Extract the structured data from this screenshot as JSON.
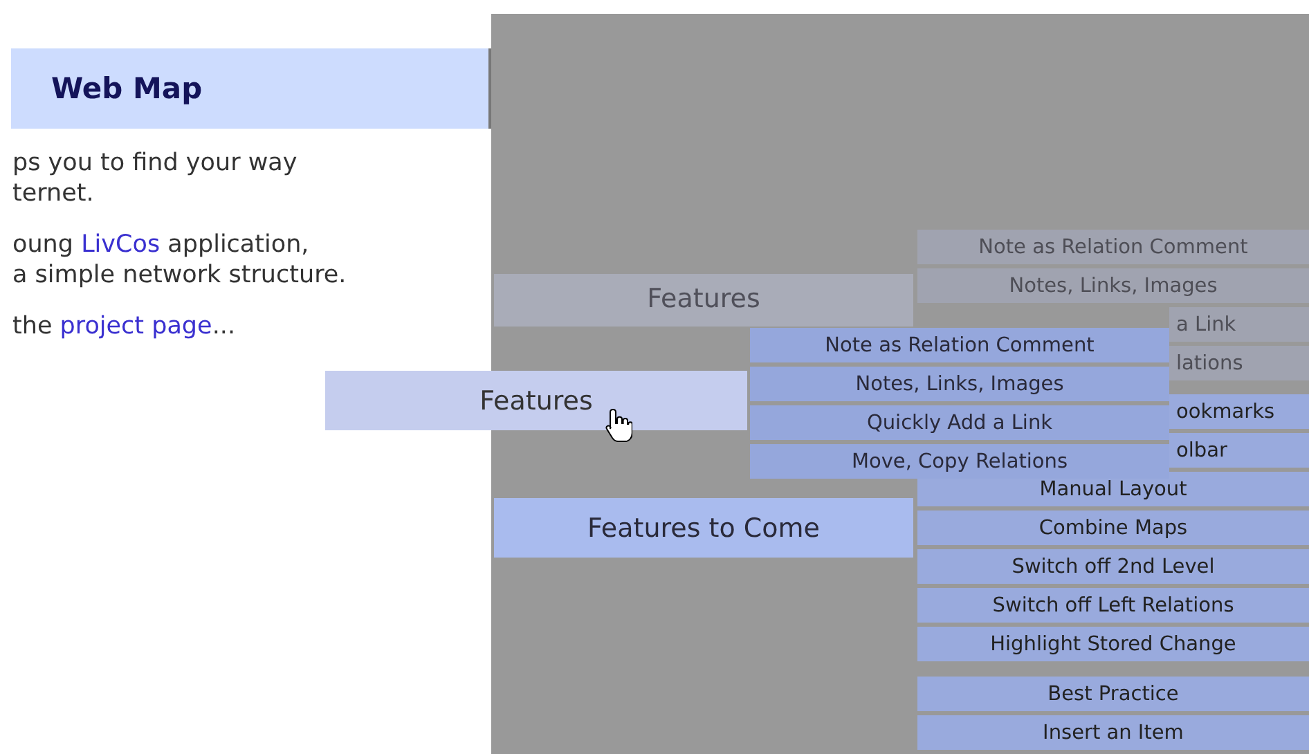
{
  "panel": {
    "title": "Web Map",
    "paragraphs": [
      {
        "lines": [
          [
            {
              "text": "ps you to find your way"
            }
          ],
          [
            {
              "text": "ternet."
            }
          ]
        ]
      },
      {
        "lines": [
          [
            {
              "text": "oung "
            },
            {
              "text": "LivCos",
              "link": true
            },
            {
              "text": " application,"
            }
          ],
          [
            {
              "text": "a simple network structure."
            }
          ]
        ]
      },
      {
        "lines": [
          [
            {
              "text": "the "
            },
            {
              "text": "project page",
              "link": true
            },
            {
              "text": "..."
            }
          ]
        ]
      }
    ]
  },
  "map": {
    "nodes": [
      {
        "label": "Features",
        "faded": true,
        "hovered": false
      },
      {
        "label": "Features",
        "faded": false,
        "hovered": true
      },
      {
        "label": "Features to Come",
        "faded": false,
        "hovered": false
      }
    ],
    "submenus": [
      {
        "faded": true,
        "groups": [
          [
            {
              "text": "Note as Relation Comment",
              "kind": "full"
            },
            {
              "text": "Notes, Links, Images",
              "kind": "full"
            },
            {
              "text": "a Link",
              "kind": "partial"
            },
            {
              "text": "lations",
              "kind": "partial"
            }
          ]
        ]
      },
      {
        "faded": false,
        "groups": [
          [
            {
              "text": "ookmarks",
              "kind": "partial"
            },
            {
              "text": "olbar",
              "kind": "partial"
            },
            {
              "text": "Manual Layout",
              "kind": "full"
            },
            {
              "text": "Combine Maps",
              "kind": "full"
            },
            {
              "text": "Switch off 2nd Level",
              "kind": "full"
            },
            {
              "text": "Switch off Left Relations",
              "kind": "full"
            },
            {
              "text": "Highlight Stored Change",
              "kind": "full"
            }
          ],
          [
            {
              "text": "Best Practice",
              "kind": "full"
            },
            {
              "text": "Insert an Item",
              "kind": "full"
            }
          ]
        ]
      },
      {
        "faded": false,
        "groups": [
          [
            {
              "text": "Note as Relation Comment",
              "kind": "full"
            },
            {
              "text": "Notes, Links, Images",
              "kind": "full"
            },
            {
              "text": "Quickly Add a Link",
              "kind": "full"
            },
            {
              "text": "Move, Copy Relations",
              "kind": "full"
            }
          ]
        ]
      }
    ]
  }
}
